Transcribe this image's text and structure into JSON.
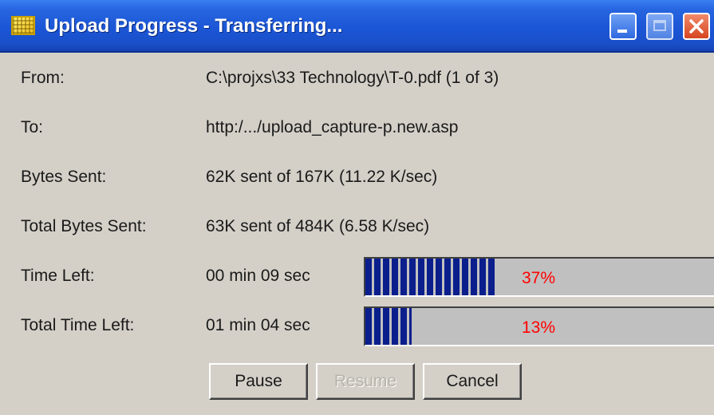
{
  "window": {
    "title": "Upload Progress - Transferring..."
  },
  "rows": {
    "from": {
      "label": "From:",
      "value": "C:\\projxs\\33 Technology\\T-0.pdf (1 of 3)"
    },
    "to": {
      "label": "To:",
      "value": "http:/.../upload_capture-p.new.asp"
    },
    "bytes_sent": {
      "label": "Bytes Sent:",
      "value": "62K sent of 167K (11.22 K/sec)"
    },
    "total_bytes_sent": {
      "label": "Total Bytes Sent:",
      "value": "63K sent of 484K (6.58 K/sec)"
    },
    "time_left": {
      "label": "Time Left:",
      "value": "00 min 09 sec",
      "percent_text": "37%",
      "progress": 0.37
    },
    "total_time_left": {
      "label": "Total Time Left:",
      "value": "01 min 04 sec",
      "percent_text": "13%",
      "progress": 0.13
    }
  },
  "buttons": {
    "pause": "Pause",
    "resume": "Resume",
    "cancel": "Cancel"
  },
  "colors": {
    "titlebar": "#1b56d6",
    "progress_fill": "#0a1e8c",
    "percent_text": "#ff0000",
    "window_bg": "#d4d0c8"
  },
  "icons": {
    "app": "upload-progress-app-icon",
    "minimize": "minimize-icon",
    "maximize": "maximize-icon",
    "close": "close-icon"
  }
}
